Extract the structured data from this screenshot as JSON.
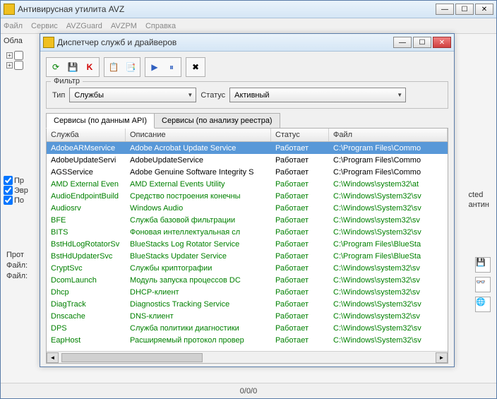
{
  "main": {
    "title": "Антивирусная утилита AVZ",
    "menu": [
      "Файл",
      "Сервис",
      "AVZGuard",
      "AVZPM",
      "Справка"
    ],
    "bg_tab": "Обла",
    "checks": [
      "Пр",
      "Эвр",
      "По"
    ],
    "prot_label": "Прот",
    "file_labels": [
      "Файл:",
      "Файл:"
    ],
    "right_hints": [
      "cted",
      "антин"
    ],
    "status": "0/0/0"
  },
  "dialog": {
    "title": "Диспетчер служб и драйверов",
    "filter_label": "Фильтр",
    "type_label": "Тип",
    "type_value": "Службы",
    "status_label": "Статус",
    "status_value": "Активный",
    "tabs": [
      "Сервисы (по данным API)",
      "Сервисы (по анализу реестра)"
    ],
    "headers": [
      "Служба",
      "Описание",
      "Статус",
      "Файл"
    ],
    "rows": [
      {
        "cls": "sel",
        "v": [
          "AdobeARMservice",
          "Adobe Acrobat Update Service",
          "Работает",
          "C:\\Program Files\\Commo"
        ]
      },
      {
        "cls": "black",
        "v": [
          "AdobeUpdateServi",
          "AdobeUpdateService",
          "Работает",
          "C:\\Program Files\\Commo"
        ]
      },
      {
        "cls": "black",
        "v": [
          "AGSService",
          "Adobe Genuine Software Integrity S",
          "Работает",
          "C:\\Program Files\\Commo"
        ]
      },
      {
        "cls": "green",
        "v": [
          "AMD External Even",
          "AMD External Events Utility",
          "Работает",
          "C:\\Windows\\system32\\at"
        ]
      },
      {
        "cls": "green",
        "v": [
          "AudioEndpointBuild",
          "Средство построения конечны",
          "Работает",
          "C:\\Windows\\System32\\sv"
        ]
      },
      {
        "cls": "green",
        "v": [
          "Audiosrv",
          "Windows Audio",
          "Работает",
          "C:\\Windows\\System32\\sv"
        ]
      },
      {
        "cls": "green",
        "v": [
          "BFE",
          "Служба базовой фильтрации",
          "Работает",
          "C:\\Windows\\system32\\sv"
        ]
      },
      {
        "cls": "green",
        "v": [
          "BITS",
          "Фоновая интеллектуальная сл",
          "Работает",
          "C:\\Windows\\System32\\sv"
        ]
      },
      {
        "cls": "green",
        "v": [
          "BstHdLogRotatorSv",
          "BlueStacks Log Rotator Service",
          "Работает",
          "C:\\Program Files\\BlueSta"
        ]
      },
      {
        "cls": "green",
        "v": [
          "BstHdUpdaterSvc",
          "BlueStacks Updater Service",
          "Работает",
          "C:\\Program Files\\BlueSta"
        ]
      },
      {
        "cls": "green",
        "v": [
          "CryptSvc",
          "Службы криптографии",
          "Работает",
          "C:\\Windows\\system32\\sv"
        ]
      },
      {
        "cls": "green",
        "v": [
          "DcomLaunch",
          "Модуль запуска процессов DC",
          "Работает",
          "C:\\Windows\\system32\\sv"
        ]
      },
      {
        "cls": "green",
        "v": [
          "Dhcp",
          "DHCP-клиент",
          "Работает",
          "C:\\Windows\\system32\\sv"
        ]
      },
      {
        "cls": "green",
        "v": [
          "DiagTrack",
          "Diagnostics Tracking Service",
          "Работает",
          "C:\\Windows\\System32\\sv"
        ]
      },
      {
        "cls": "green",
        "v": [
          "Dnscache",
          "DNS-клиент",
          "Работает",
          "C:\\Windows\\system32\\sv"
        ]
      },
      {
        "cls": "green",
        "v": [
          "DPS",
          "Служба политики диагностики",
          "Работает",
          "C:\\Windows\\System32\\sv"
        ]
      },
      {
        "cls": "green",
        "v": [
          "EapHost",
          "Расширяемый протокол провер",
          "Работает",
          "C:\\Windows\\System32\\sv"
        ]
      }
    ]
  }
}
